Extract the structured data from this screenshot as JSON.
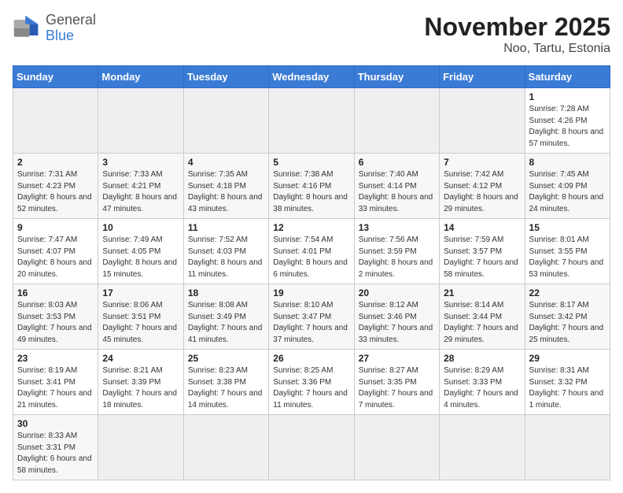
{
  "header": {
    "logo_text_general": "General",
    "logo_text_blue": "Blue",
    "title": "November 2025",
    "subtitle": "Noo, Tartu, Estonia"
  },
  "weekdays": [
    "Sunday",
    "Monday",
    "Tuesday",
    "Wednesday",
    "Thursday",
    "Friday",
    "Saturday"
  ],
  "days": {
    "d1": {
      "num": "1",
      "rise": "7:28 AM",
      "set": "4:26 PM",
      "daylight": "8 hours and 57 minutes."
    },
    "d2": {
      "num": "2",
      "rise": "7:31 AM",
      "set": "4:23 PM",
      "daylight": "8 hours and 52 minutes."
    },
    "d3": {
      "num": "3",
      "rise": "7:33 AM",
      "set": "4:21 PM",
      "daylight": "8 hours and 47 minutes."
    },
    "d4": {
      "num": "4",
      "rise": "7:35 AM",
      "set": "4:18 PM",
      "daylight": "8 hours and 43 minutes."
    },
    "d5": {
      "num": "5",
      "rise": "7:38 AM",
      "set": "4:16 PM",
      "daylight": "8 hours and 38 minutes."
    },
    "d6": {
      "num": "6",
      "rise": "7:40 AM",
      "set": "4:14 PM",
      "daylight": "8 hours and 33 minutes."
    },
    "d7": {
      "num": "7",
      "rise": "7:42 AM",
      "set": "4:12 PM",
      "daylight": "8 hours and 29 minutes."
    },
    "d8": {
      "num": "8",
      "rise": "7:45 AM",
      "set": "4:09 PM",
      "daylight": "8 hours and 24 minutes."
    },
    "d9": {
      "num": "9",
      "rise": "7:47 AM",
      "set": "4:07 PM",
      "daylight": "8 hours and 20 minutes."
    },
    "d10": {
      "num": "10",
      "rise": "7:49 AM",
      "set": "4:05 PM",
      "daylight": "8 hours and 15 minutes."
    },
    "d11": {
      "num": "11",
      "rise": "7:52 AM",
      "set": "4:03 PM",
      "daylight": "8 hours and 11 minutes."
    },
    "d12": {
      "num": "12",
      "rise": "7:54 AM",
      "set": "4:01 PM",
      "daylight": "8 hours and 6 minutes."
    },
    "d13": {
      "num": "13",
      "rise": "7:56 AM",
      "set": "3:59 PM",
      "daylight": "8 hours and 2 minutes."
    },
    "d14": {
      "num": "14",
      "rise": "7:59 AM",
      "set": "3:57 PM",
      "daylight": "7 hours and 58 minutes."
    },
    "d15": {
      "num": "15",
      "rise": "8:01 AM",
      "set": "3:55 PM",
      "daylight": "7 hours and 53 minutes."
    },
    "d16": {
      "num": "16",
      "rise": "8:03 AM",
      "set": "3:53 PM",
      "daylight": "7 hours and 49 minutes."
    },
    "d17": {
      "num": "17",
      "rise": "8:06 AM",
      "set": "3:51 PM",
      "daylight": "7 hours and 45 minutes."
    },
    "d18": {
      "num": "18",
      "rise": "8:08 AM",
      "set": "3:49 PM",
      "daylight": "7 hours and 41 minutes."
    },
    "d19": {
      "num": "19",
      "rise": "8:10 AM",
      "set": "3:47 PM",
      "daylight": "7 hours and 37 minutes."
    },
    "d20": {
      "num": "20",
      "rise": "8:12 AM",
      "set": "3:46 PM",
      "daylight": "7 hours and 33 minutes."
    },
    "d21": {
      "num": "21",
      "rise": "8:14 AM",
      "set": "3:44 PM",
      "daylight": "7 hours and 29 minutes."
    },
    "d22": {
      "num": "22",
      "rise": "8:17 AM",
      "set": "3:42 PM",
      "daylight": "7 hours and 25 minutes."
    },
    "d23": {
      "num": "23",
      "rise": "8:19 AM",
      "set": "3:41 PM",
      "daylight": "7 hours and 21 minutes."
    },
    "d24": {
      "num": "24",
      "rise": "8:21 AM",
      "set": "3:39 PM",
      "daylight": "7 hours and 18 minutes."
    },
    "d25": {
      "num": "25",
      "rise": "8:23 AM",
      "set": "3:38 PM",
      "daylight": "7 hours and 14 minutes."
    },
    "d26": {
      "num": "26",
      "rise": "8:25 AM",
      "set": "3:36 PM",
      "daylight": "7 hours and 11 minutes."
    },
    "d27": {
      "num": "27",
      "rise": "8:27 AM",
      "set": "3:35 PM",
      "daylight": "7 hours and 7 minutes."
    },
    "d28": {
      "num": "28",
      "rise": "8:29 AM",
      "set": "3:33 PM",
      "daylight": "7 hours and 4 minutes."
    },
    "d29": {
      "num": "29",
      "rise": "8:31 AM",
      "set": "3:32 PM",
      "daylight": "7 hours and 1 minute."
    },
    "d30": {
      "num": "30",
      "rise": "8:33 AM",
      "set": "3:31 PM",
      "daylight": "6 hours and 58 minutes."
    }
  },
  "labels": {
    "sunrise": "Sunrise:",
    "sunset": "Sunset:",
    "daylight": "Daylight:"
  }
}
